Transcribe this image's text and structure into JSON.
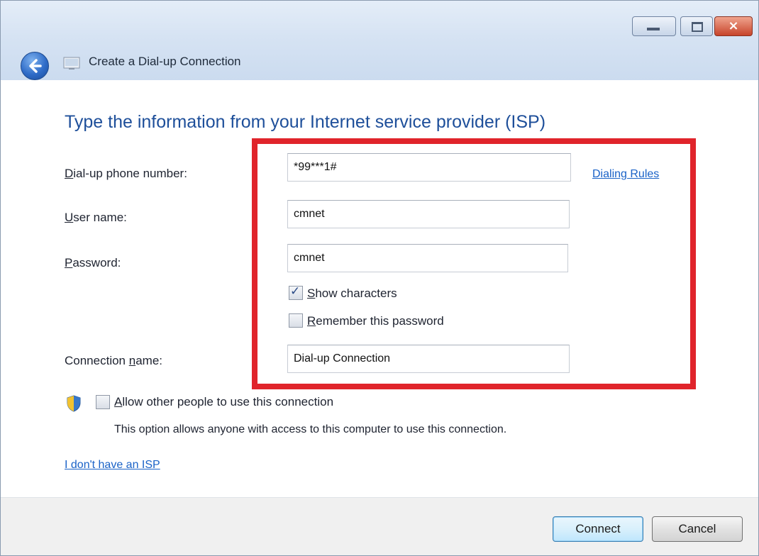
{
  "window": {
    "title": "Create a Dial-up Connection",
    "controls": {
      "close_glyph": "×"
    }
  },
  "heading": "Type the information from your Internet service provider (ISP)",
  "form": {
    "phone": {
      "label_prefix": "D",
      "label_rest": "ial-up phone number:",
      "value": "*99***1#"
    },
    "username": {
      "label_prefix": "U",
      "label_rest": "ser name:",
      "value": "cmnet"
    },
    "password": {
      "label_prefix": "P",
      "label_rest": "assword:",
      "value": "cmnet"
    },
    "show_characters": {
      "label_prefix": "S",
      "label_rest": "how characters",
      "checked": true
    },
    "remember_password": {
      "label_prefix": "R",
      "label_rest": "emember this password",
      "checked": false
    },
    "connection_name": {
      "label_before": "Connection ",
      "label_underlined": "n",
      "label_rest": "ame:",
      "value": "Dial-up Connection"
    },
    "dialing_rules_link": "Dialing Rules",
    "allow_others": {
      "label_prefix": "A",
      "label_rest": "llow other people to use this connection",
      "checked": false
    },
    "allow_others_note": "This option allows anyone with access to this computer to use this connection."
  },
  "no_isp_link": "I don't have an ISP",
  "buttons": {
    "connect": "Connect",
    "cancel": "Cancel"
  },
  "colors": {
    "highlight": "#e0242b",
    "heading": "#1e4f9a",
    "link": "#1a62c7"
  }
}
